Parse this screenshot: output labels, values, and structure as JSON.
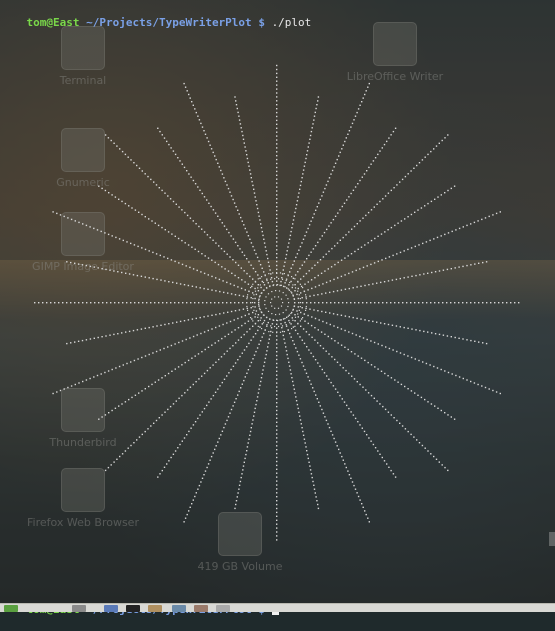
{
  "desktop": {
    "icons": [
      {
        "name": "terminal-desktop-icon",
        "label": "Terminal"
      },
      {
        "name": "gnumeric-desktop-icon",
        "label": "Gnumeric"
      },
      {
        "name": "libreoffice-writer-desktop-icon",
        "label": "LibreOffice Writer"
      },
      {
        "name": "gimp-desktop-icon",
        "label": "GIMP Image Editor"
      },
      {
        "name": "thunderbird-desktop-icon",
        "label": "Thunderbird"
      },
      {
        "name": "firefox-desktop-icon",
        "label": "Firefox Web Browser"
      },
      {
        "name": "volume-desktop-icon",
        "label": "419 GB Volume"
      }
    ]
  },
  "terminal": {
    "prompt_user": "tom@East",
    "prompt_path": "~/Projects/TypeWriterPlot",
    "prompt_symbol": "$",
    "command": "./plot",
    "colors": {
      "user": "#7ad84a",
      "path": "#7aa0e6",
      "plot": "#d8d8d8"
    }
  },
  "taskbar": {
    "items": [
      "menu-icon",
      "files-icon",
      "terminal-icon",
      "folder-icon",
      "browser-icon",
      "image-icon",
      "settings-icon"
    ]
  }
}
